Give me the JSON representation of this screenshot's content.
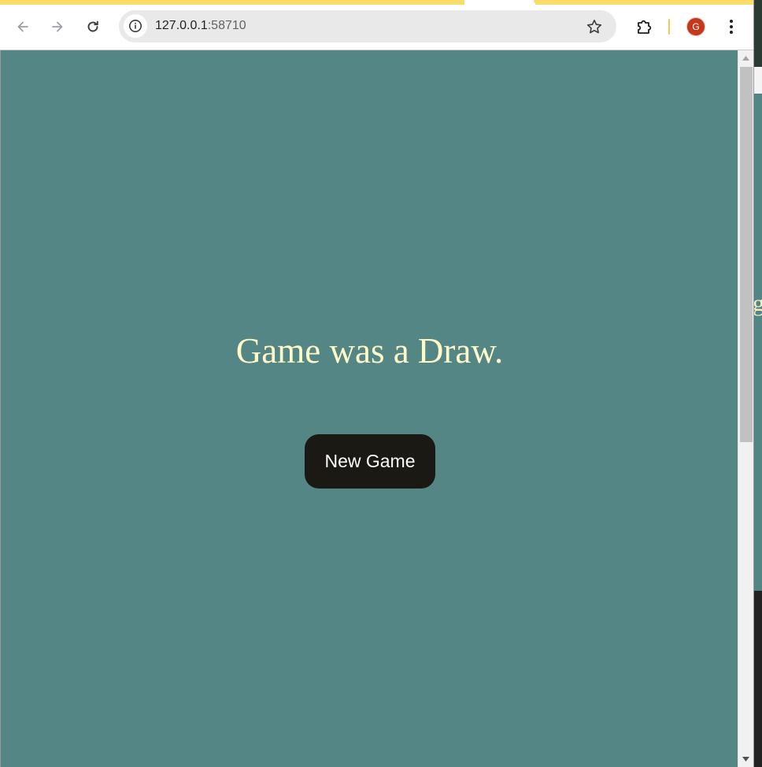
{
  "browser": {
    "url_host": "127.0.0.1",
    "url_port": ":58710",
    "profile_initial": "G",
    "icons": {
      "back": "back-arrow-icon",
      "forward": "forward-arrow-icon",
      "reload": "reload-icon",
      "site_info": "info-icon",
      "bookmark": "star-icon",
      "extensions": "puzzle-icon",
      "menu": "kebab-menu-icon"
    },
    "colors": {
      "tabstrip": "#f9dd68",
      "avatar": "#c4391c"
    }
  },
  "page": {
    "result_message": "Game was a Draw.",
    "new_game_label": "New Game",
    "colors": {
      "background": "#538685",
      "message_text": "#fefbc9",
      "button_bg": "#1a1914",
      "button_text": "#ffffff"
    }
  },
  "background_window": {
    "clipped_text": "g"
  }
}
